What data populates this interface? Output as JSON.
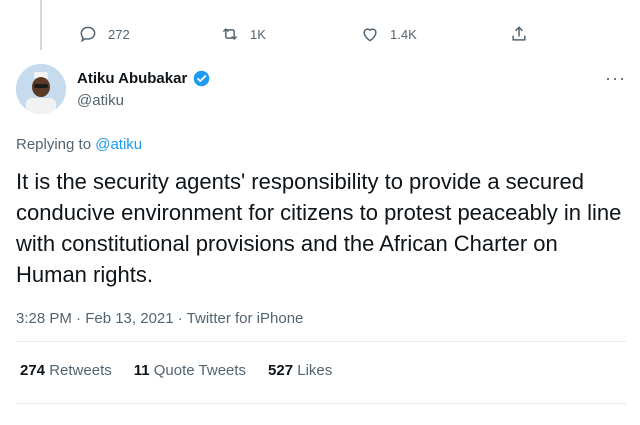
{
  "actions": {
    "reply_count": "272",
    "retweet_count": "1K",
    "like_count": "1.4K"
  },
  "author": {
    "name": "Atiku Abubakar",
    "handle": "@atiku"
  },
  "replying": {
    "prefix": "Replying to",
    "mention": "@atiku"
  },
  "tweet": {
    "text": "It is the security agents' responsibility to provide a secured conducive environment for citizens to protest peaceably in line with constitutional provisions and the African Charter on Human rights.",
    "timestamp": "3:28 PM · Feb 13, 2021 · Twitter for iPhone"
  },
  "stats": {
    "retweets_value": "274",
    "retweets_label": "Retweets",
    "quotes_value": "11",
    "quotes_label": "Quote Tweets",
    "likes_value": "527",
    "likes_label": "Likes"
  },
  "colors": {
    "accent": "#1d9bf0",
    "text": "#0f1419",
    "muted": "#536471"
  }
}
